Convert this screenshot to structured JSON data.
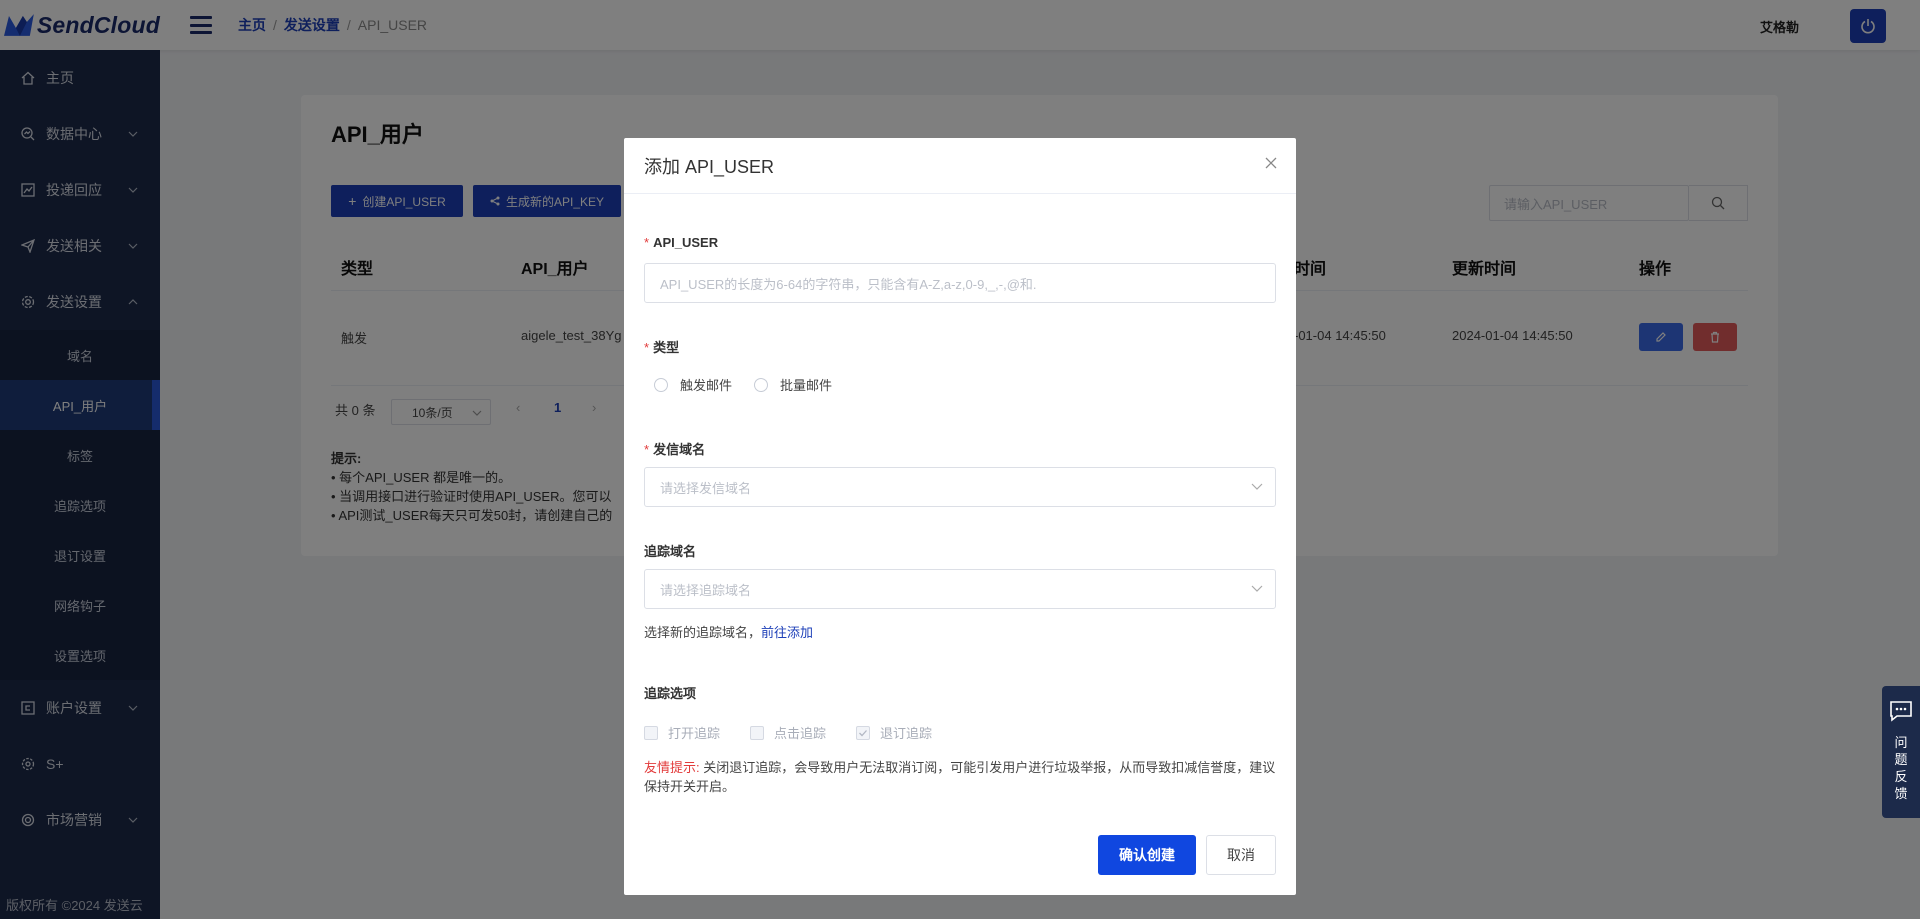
{
  "header": {
    "logo_text": "SendCloud",
    "breadcrumb": [
      "主页",
      "发送设置",
      "API_USER"
    ],
    "user_name": "艾格勒"
  },
  "sidebar": {
    "items": [
      {
        "label": "主页",
        "icon": "home-icon"
      },
      {
        "label": "数据中心",
        "icon": "data-center-icon"
      },
      {
        "label": "投递回应",
        "icon": "chart-icon"
      },
      {
        "label": "发送相关",
        "icon": "send-icon"
      },
      {
        "label": "发送设置",
        "icon": "settings-icon"
      },
      {
        "label": "账户设置",
        "icon": "account-icon"
      },
      {
        "label": "S+",
        "icon": "splus-icon"
      },
      {
        "label": "市场营销",
        "icon": "marketing-icon"
      }
    ],
    "submenu": [
      "域名",
      "API_用户",
      "标签",
      "追踪选项",
      "退订设置",
      "网络钩子",
      "设置选项"
    ],
    "copyright": "版权所有 ©2024 发送云"
  },
  "main": {
    "title": "API_用户",
    "create_button": "创建API_USER",
    "generate_key_button": "生成新的API_KEY",
    "search_placeholder": "请输入API_USER",
    "table_headers": [
      "类型",
      "API_用户",
      "时间",
      "更新时间",
      "操作"
    ],
    "row": {
      "type": "触发",
      "api_user": "aigele_test_38Yg",
      "created": "-01-04 14:45:50",
      "updated": "2024-01-04 14:45:50"
    },
    "pager": {
      "total": "共 0 条",
      "page_size": "10条/页",
      "current_page": "1"
    },
    "tips": {
      "title": "提示:",
      "lines": [
        "• 每个API_USER 都是唯一的。",
        "• 当调用接口进行验证时使用API_USER。您可以",
        "• API测试_USER每天只可发50封，请创建自己的"
      ]
    }
  },
  "modal": {
    "title": "添加 API_USER",
    "api_user_label": "API_USER",
    "api_user_placeholder": "API_USER的长度为6-64的字符串，只能含有A-Z,a-z,0-9,_,-,@和.",
    "type_label": "类型",
    "type_options": [
      "触发邮件",
      "批量邮件"
    ],
    "domain_label": "发信域名",
    "domain_placeholder": "请选择发信域名",
    "tracking_domain_label": "追踪域名",
    "tracking_domain_placeholder": "请选择追踪域名",
    "hint_text": "选择新的追踪域名，",
    "hint_link": "前往添加",
    "tracking_options_label": "追踪选项",
    "tracking_options": [
      {
        "label": "打开追踪",
        "checked": false
      },
      {
        "label": "点击追踪",
        "checked": false
      },
      {
        "label": "退订追踪",
        "checked": true
      }
    ],
    "warning_label": "友情提示:",
    "warning_text": " 关闭退订追踪，会导致用户无法取消订阅，可能引发用户进行垃圾举报，从而导致扣减信誉度，建议保持开关开启。",
    "confirm_button": "确认创建",
    "cancel_button": "取消"
  },
  "feedback": {
    "label": "问题反馈"
  },
  "colors": {
    "brand": "#1d3fb8",
    "sidebar_bg": "#1c2a4a",
    "required": "#e23b3b",
    "confirm": "#1047e0"
  }
}
